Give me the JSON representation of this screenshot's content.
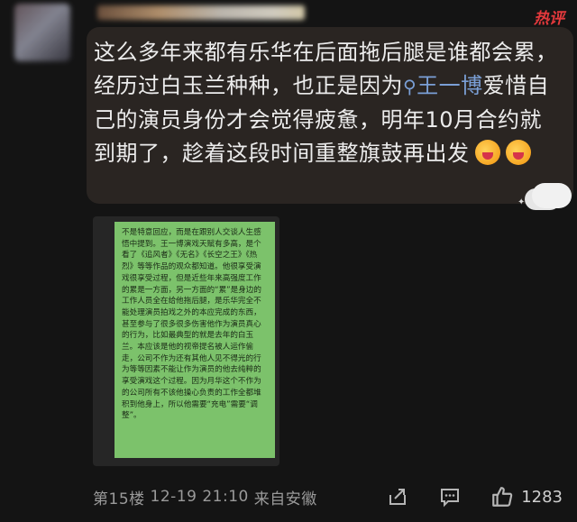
{
  "header": {
    "hot_badge": "热评"
  },
  "comment": {
    "text_before": "这么多年来都有乐华在后面拖后腿是谁都会累，经历过白玉兰种种，也正是因为",
    "mention_icon": "search-icon",
    "mention": "王一博",
    "text_after": "爱惜自己的演员身份才会觉得疲惫，明年10月合约就到期了，趁着这段时间重整旗鼓再出发",
    "emojis": [
      "hug-emoji",
      "hug-emoji"
    ]
  },
  "image_note": {
    "text": "不是特意回应，而是在跟别人交谈人生感悟中提到。王一博演戏天赋有多高，是个看了《追风者》《无名》《长空之王》《热烈》等等作品的观众都知道。他很享受演戏很享受过程，但是近些年来高强度工作的累是一方面，另一方面的“累”是身边的工作人员全在给他拖后腿，是乐华完全不能处理演员拍戏之外的本应完成的东西，甚至参与了很多很多伤害他作为演员真心的行为，比如最典型的就是去年的白玉兰。本应该是他的视帝提名被人运作偷走，公司不作为还有其他人见不得光的行为等等因素不能让作为演员的他去纯粹的享受演戏这个过程。因为月华这个不作为的公司所有不该他操心负责的工作全都堆积到他身上，所以他需要“充电”需要“调整”。"
  },
  "footer": {
    "floor": "第15楼",
    "time": "12-19 21:10",
    "location": "来自安徽",
    "share_icon": "share-icon",
    "reply_icon": "comment-icon",
    "like_icon": "thumbs-up-icon",
    "like_count": "1283"
  },
  "colors": {
    "background": "#141414",
    "bubble": "#2a2522",
    "mention": "#7a9fd6",
    "hot_badge": "#e4393c",
    "note_bg": "#7cc26b"
  }
}
